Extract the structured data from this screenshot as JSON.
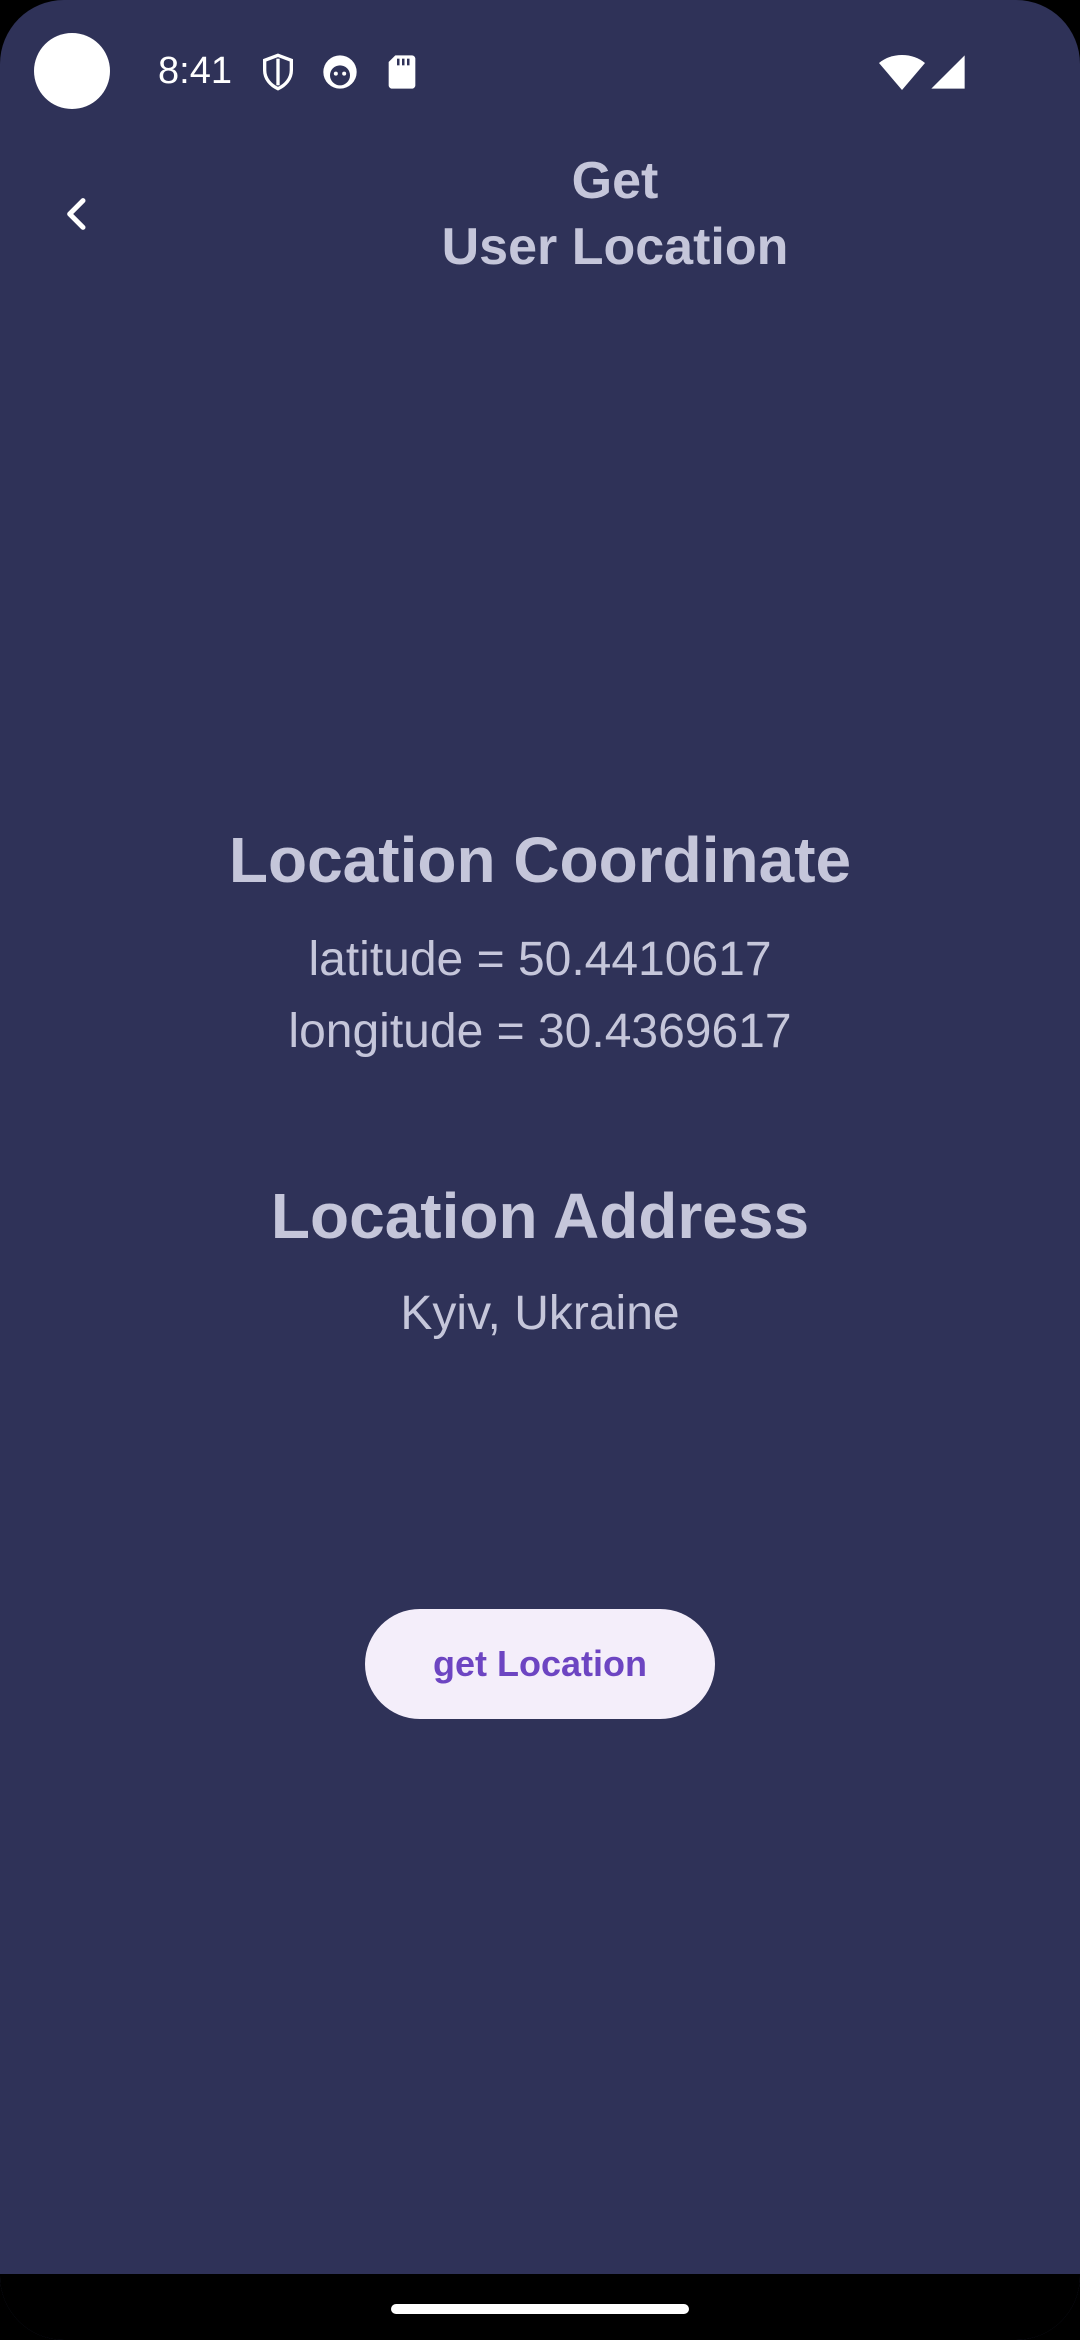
{
  "status_bar": {
    "time": "8:41",
    "icons": [
      "shield-icon",
      "robot-face-icon",
      "sd-card-icon",
      "wifi-icon",
      "signal-icon"
    ]
  },
  "app_bar": {
    "back_icon": "chevron-left-icon",
    "title_line1": "Get",
    "title_line2": "User Location"
  },
  "coordinates": {
    "heading": "Location Coordinate",
    "latitude_text": "latitude = 50.4410617",
    "longitude_text": "longitude = 30.4369617"
  },
  "address": {
    "heading": "Location Address",
    "value": "Kyiv, Ukraine"
  },
  "actions": {
    "get_location_label": "get Location"
  },
  "colors": {
    "background": "#2F3258",
    "text": "#C5C6DA",
    "button_bg": "#F4EEFA",
    "button_text": "#6D45C2"
  }
}
